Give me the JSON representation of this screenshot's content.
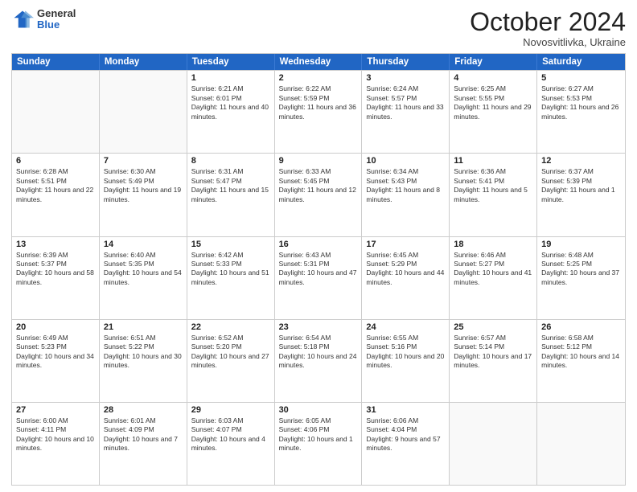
{
  "header": {
    "logo": {
      "general": "General",
      "blue": "Blue"
    },
    "title": "October 2024",
    "subtitle": "Novosvitlivka, Ukraine"
  },
  "days_of_week": [
    "Sunday",
    "Monday",
    "Tuesday",
    "Wednesday",
    "Thursday",
    "Friday",
    "Saturday"
  ],
  "weeks": [
    [
      {
        "day": "",
        "empty": true
      },
      {
        "day": "",
        "empty": true
      },
      {
        "day": "1",
        "sunrise": "Sunrise: 6:21 AM",
        "sunset": "Sunset: 6:01 PM",
        "daylight": "Daylight: 11 hours and 40 minutes."
      },
      {
        "day": "2",
        "sunrise": "Sunrise: 6:22 AM",
        "sunset": "Sunset: 5:59 PM",
        "daylight": "Daylight: 11 hours and 36 minutes."
      },
      {
        "day": "3",
        "sunrise": "Sunrise: 6:24 AM",
        "sunset": "Sunset: 5:57 PM",
        "daylight": "Daylight: 11 hours and 33 minutes."
      },
      {
        "day": "4",
        "sunrise": "Sunrise: 6:25 AM",
        "sunset": "Sunset: 5:55 PM",
        "daylight": "Daylight: 11 hours and 29 minutes."
      },
      {
        "day": "5",
        "sunrise": "Sunrise: 6:27 AM",
        "sunset": "Sunset: 5:53 PM",
        "daylight": "Daylight: 11 hours and 26 minutes."
      }
    ],
    [
      {
        "day": "6",
        "sunrise": "Sunrise: 6:28 AM",
        "sunset": "Sunset: 5:51 PM",
        "daylight": "Daylight: 11 hours and 22 minutes."
      },
      {
        "day": "7",
        "sunrise": "Sunrise: 6:30 AM",
        "sunset": "Sunset: 5:49 PM",
        "daylight": "Daylight: 11 hours and 19 minutes."
      },
      {
        "day": "8",
        "sunrise": "Sunrise: 6:31 AM",
        "sunset": "Sunset: 5:47 PM",
        "daylight": "Daylight: 11 hours and 15 minutes."
      },
      {
        "day": "9",
        "sunrise": "Sunrise: 6:33 AM",
        "sunset": "Sunset: 5:45 PM",
        "daylight": "Daylight: 11 hours and 12 minutes."
      },
      {
        "day": "10",
        "sunrise": "Sunrise: 6:34 AM",
        "sunset": "Sunset: 5:43 PM",
        "daylight": "Daylight: 11 hours and 8 minutes."
      },
      {
        "day": "11",
        "sunrise": "Sunrise: 6:36 AM",
        "sunset": "Sunset: 5:41 PM",
        "daylight": "Daylight: 11 hours and 5 minutes."
      },
      {
        "day": "12",
        "sunrise": "Sunrise: 6:37 AM",
        "sunset": "Sunset: 5:39 PM",
        "daylight": "Daylight: 11 hours and 1 minute."
      }
    ],
    [
      {
        "day": "13",
        "sunrise": "Sunrise: 6:39 AM",
        "sunset": "Sunset: 5:37 PM",
        "daylight": "Daylight: 10 hours and 58 minutes."
      },
      {
        "day": "14",
        "sunrise": "Sunrise: 6:40 AM",
        "sunset": "Sunset: 5:35 PM",
        "daylight": "Daylight: 10 hours and 54 minutes."
      },
      {
        "day": "15",
        "sunrise": "Sunrise: 6:42 AM",
        "sunset": "Sunset: 5:33 PM",
        "daylight": "Daylight: 10 hours and 51 minutes."
      },
      {
        "day": "16",
        "sunrise": "Sunrise: 6:43 AM",
        "sunset": "Sunset: 5:31 PM",
        "daylight": "Daylight: 10 hours and 47 minutes."
      },
      {
        "day": "17",
        "sunrise": "Sunrise: 6:45 AM",
        "sunset": "Sunset: 5:29 PM",
        "daylight": "Daylight: 10 hours and 44 minutes."
      },
      {
        "day": "18",
        "sunrise": "Sunrise: 6:46 AM",
        "sunset": "Sunset: 5:27 PM",
        "daylight": "Daylight: 10 hours and 41 minutes."
      },
      {
        "day": "19",
        "sunrise": "Sunrise: 6:48 AM",
        "sunset": "Sunset: 5:25 PM",
        "daylight": "Daylight: 10 hours and 37 minutes."
      }
    ],
    [
      {
        "day": "20",
        "sunrise": "Sunrise: 6:49 AM",
        "sunset": "Sunset: 5:23 PM",
        "daylight": "Daylight: 10 hours and 34 minutes."
      },
      {
        "day": "21",
        "sunrise": "Sunrise: 6:51 AM",
        "sunset": "Sunset: 5:22 PM",
        "daylight": "Daylight: 10 hours and 30 minutes."
      },
      {
        "day": "22",
        "sunrise": "Sunrise: 6:52 AM",
        "sunset": "Sunset: 5:20 PM",
        "daylight": "Daylight: 10 hours and 27 minutes."
      },
      {
        "day": "23",
        "sunrise": "Sunrise: 6:54 AM",
        "sunset": "Sunset: 5:18 PM",
        "daylight": "Daylight: 10 hours and 24 minutes."
      },
      {
        "day": "24",
        "sunrise": "Sunrise: 6:55 AM",
        "sunset": "Sunset: 5:16 PM",
        "daylight": "Daylight: 10 hours and 20 minutes."
      },
      {
        "day": "25",
        "sunrise": "Sunrise: 6:57 AM",
        "sunset": "Sunset: 5:14 PM",
        "daylight": "Daylight: 10 hours and 17 minutes."
      },
      {
        "day": "26",
        "sunrise": "Sunrise: 6:58 AM",
        "sunset": "Sunset: 5:12 PM",
        "daylight": "Daylight: 10 hours and 14 minutes."
      }
    ],
    [
      {
        "day": "27",
        "sunrise": "Sunrise: 6:00 AM",
        "sunset": "Sunset: 4:11 PM",
        "daylight": "Daylight: 10 hours and 10 minutes."
      },
      {
        "day": "28",
        "sunrise": "Sunrise: 6:01 AM",
        "sunset": "Sunset: 4:09 PM",
        "daylight": "Daylight: 10 hours and 7 minutes."
      },
      {
        "day": "29",
        "sunrise": "Sunrise: 6:03 AM",
        "sunset": "Sunset: 4:07 PM",
        "daylight": "Daylight: 10 hours and 4 minutes."
      },
      {
        "day": "30",
        "sunrise": "Sunrise: 6:05 AM",
        "sunset": "Sunset: 4:06 PM",
        "daylight": "Daylight: 10 hours and 1 minute."
      },
      {
        "day": "31",
        "sunrise": "Sunrise: 6:06 AM",
        "sunset": "Sunset: 4:04 PM",
        "daylight": "Daylight: 9 hours and 57 minutes."
      },
      {
        "day": "",
        "empty": true
      },
      {
        "day": "",
        "empty": true
      }
    ]
  ]
}
